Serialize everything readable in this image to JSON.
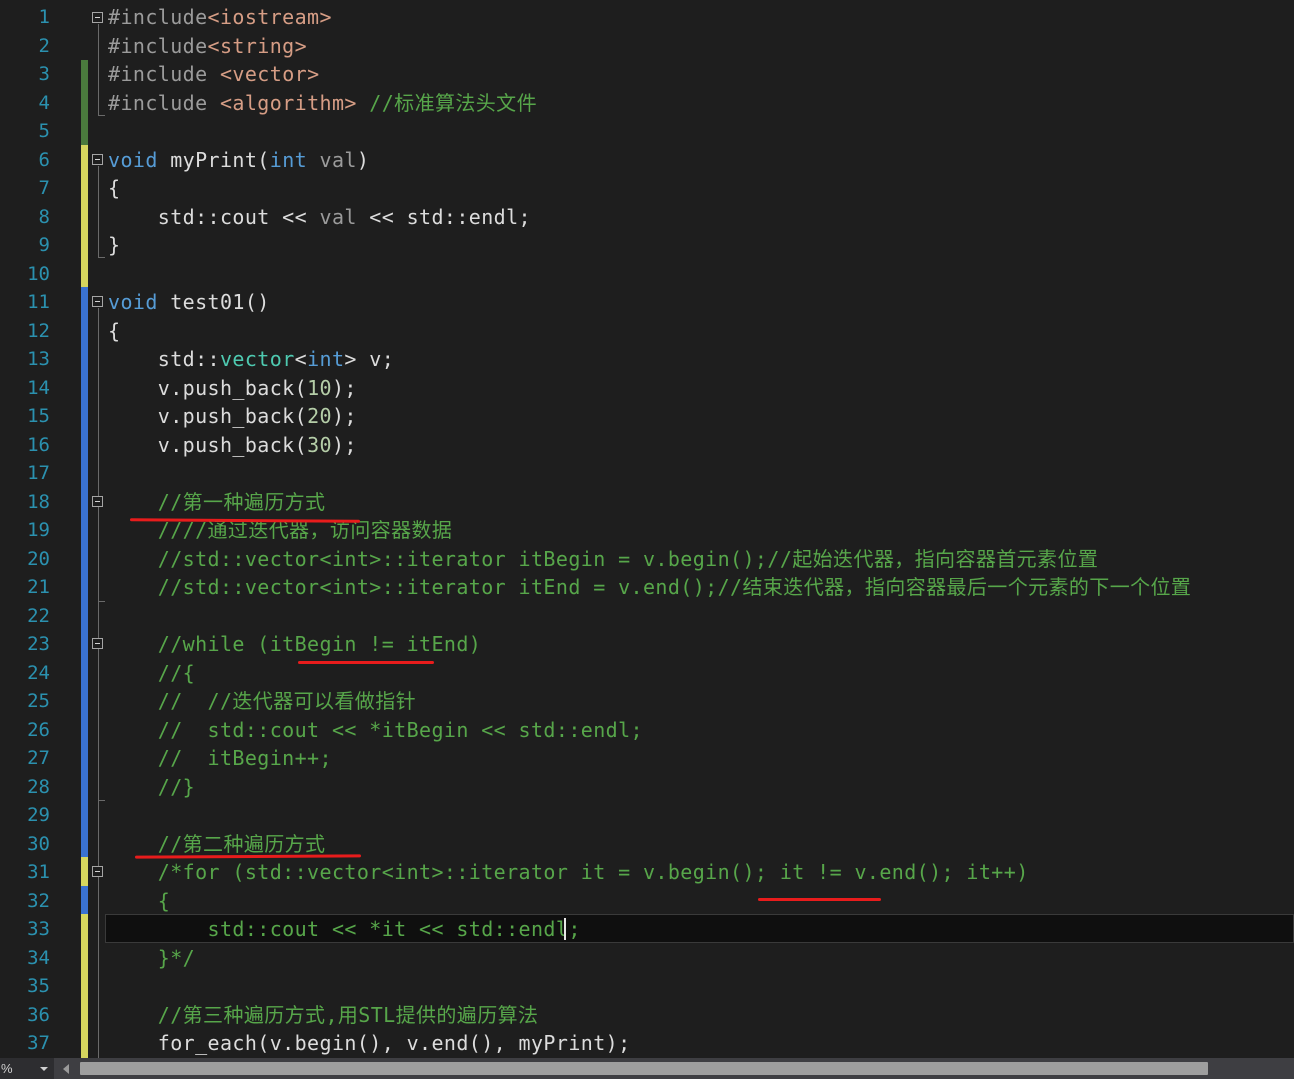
{
  "editor": {
    "lines": [
      {
        "n": "1",
        "segs": [
          {
            "c": "pp",
            "t": "#include"
          },
          {
            "c": "s",
            "t": "<iostream>"
          }
        ]
      },
      {
        "n": "2",
        "segs": [
          {
            "c": "pp",
            "t": "#include"
          },
          {
            "c": "s",
            "t": "<string>"
          }
        ]
      },
      {
        "n": "3",
        "segs": [
          {
            "c": "pp",
            "t": "#include "
          },
          {
            "c": "s",
            "t": "<vector>"
          }
        ]
      },
      {
        "n": "4",
        "segs": [
          {
            "c": "pp",
            "t": "#include "
          },
          {
            "c": "s",
            "t": "<algorithm>"
          },
          {
            "c": "d",
            "t": " "
          },
          {
            "c": "c",
            "t": "//标准算法头文件"
          }
        ]
      },
      {
        "n": "5",
        "segs": []
      },
      {
        "n": "6",
        "segs": [
          {
            "c": "k",
            "t": "void"
          },
          {
            "c": "d",
            "t": " myPrint("
          },
          {
            "c": "k",
            "t": "int"
          },
          {
            "c": "p",
            "t": " val"
          },
          {
            "c": "d",
            "t": ")"
          }
        ]
      },
      {
        "n": "7",
        "segs": [
          {
            "c": "d",
            "t": "{"
          }
        ]
      },
      {
        "n": "8",
        "segs": [
          {
            "c": "d",
            "t": "    std::cout << "
          },
          {
            "c": "p",
            "t": "val"
          },
          {
            "c": "d",
            "t": " << std::endl;"
          }
        ]
      },
      {
        "n": "9",
        "segs": [
          {
            "c": "d",
            "t": "}"
          }
        ]
      },
      {
        "n": "10",
        "segs": []
      },
      {
        "n": "11",
        "segs": [
          {
            "c": "k",
            "t": "void"
          },
          {
            "c": "d",
            "t": " test01()"
          }
        ]
      },
      {
        "n": "12",
        "segs": [
          {
            "c": "d",
            "t": "{"
          }
        ]
      },
      {
        "n": "13",
        "segs": [
          {
            "c": "d",
            "t": "    std::"
          },
          {
            "c": "t",
            "t": "vector"
          },
          {
            "c": "d",
            "t": "<"
          },
          {
            "c": "k",
            "t": "int"
          },
          {
            "c": "d",
            "t": "> v;"
          }
        ]
      },
      {
        "n": "14",
        "segs": [
          {
            "c": "d",
            "t": "    v.push_back("
          },
          {
            "c": "n",
            "t": "10"
          },
          {
            "c": "d",
            "t": ");"
          }
        ]
      },
      {
        "n": "15",
        "segs": [
          {
            "c": "d",
            "t": "    v.push_back("
          },
          {
            "c": "n",
            "t": "20"
          },
          {
            "c": "d",
            "t": ");"
          }
        ]
      },
      {
        "n": "16",
        "segs": [
          {
            "c": "d",
            "t": "    v.push_back("
          },
          {
            "c": "n",
            "t": "30"
          },
          {
            "c": "d",
            "t": ");"
          }
        ]
      },
      {
        "n": "17",
        "segs": []
      },
      {
        "n": "18",
        "segs": [
          {
            "c": "c",
            "t": "    //第一种遍历方式"
          }
        ]
      },
      {
        "n": "19",
        "segs": [
          {
            "c": "c",
            "t": "    ////通过迭代器，访问容器数据"
          }
        ]
      },
      {
        "n": "20",
        "segs": [
          {
            "c": "c",
            "t": "    //std::vector<int>::iterator itBegin = v.begin();//起始迭代器，指向容器首元素位置"
          }
        ]
      },
      {
        "n": "21",
        "segs": [
          {
            "c": "c",
            "t": "    //std::vector<int>::iterator itEnd = v.end();//结束迭代器，指向容器最后一个元素的下一个位置"
          }
        ]
      },
      {
        "n": "22",
        "segs": []
      },
      {
        "n": "23",
        "segs": [
          {
            "c": "c",
            "t": "    //while (itBegin != itEnd)"
          }
        ]
      },
      {
        "n": "24",
        "segs": [
          {
            "c": "c",
            "t": "    //{"
          }
        ]
      },
      {
        "n": "25",
        "segs": [
          {
            "c": "c",
            "t": "    //  //迭代器可以看做指针"
          }
        ]
      },
      {
        "n": "26",
        "segs": [
          {
            "c": "c",
            "t": "    //  std::cout << *itBegin << std::endl;"
          }
        ]
      },
      {
        "n": "27",
        "segs": [
          {
            "c": "c",
            "t": "    //  itBegin++;"
          }
        ]
      },
      {
        "n": "28",
        "segs": [
          {
            "c": "c",
            "t": "    //}"
          }
        ]
      },
      {
        "n": "29",
        "segs": []
      },
      {
        "n": "30",
        "segs": [
          {
            "c": "c",
            "t": "    //第二种遍历方式"
          }
        ]
      },
      {
        "n": "31",
        "segs": [
          {
            "c": "c",
            "t": "    /*for (std::vector<int>::iterator it = v.begin(); it != v.end(); it++)"
          }
        ]
      },
      {
        "n": "32",
        "segs": [
          {
            "c": "c",
            "t": "    {"
          }
        ]
      },
      {
        "n": "33",
        "segs": [
          {
            "c": "c",
            "t": "        std::cout << *it << std::endl;"
          }
        ]
      },
      {
        "n": "34",
        "segs": [
          {
            "c": "c",
            "t": "    }*/"
          }
        ]
      },
      {
        "n": "35",
        "segs": []
      },
      {
        "n": "36",
        "segs": [
          {
            "c": "c",
            "t": "    //第三种遍历方式,用STL提供的遍历算法"
          }
        ]
      },
      {
        "n": "37",
        "segs": [
          {
            "c": "d",
            "t": "    for_each(v.begin(), v.end(), myPrint);"
          }
        ]
      }
    ]
  },
  "status": {
    "zoom": "%"
  },
  "colors": {
    "background": "#1e1e1e",
    "line_number": "#2b91af",
    "keyword": "#569cd6",
    "comment": "#57a64a",
    "change_saved": "#4a7a3d",
    "change_unsaved": "#d6d65e",
    "change_blue": "#3a72d1",
    "annotation_red": "#e81c1c"
  }
}
